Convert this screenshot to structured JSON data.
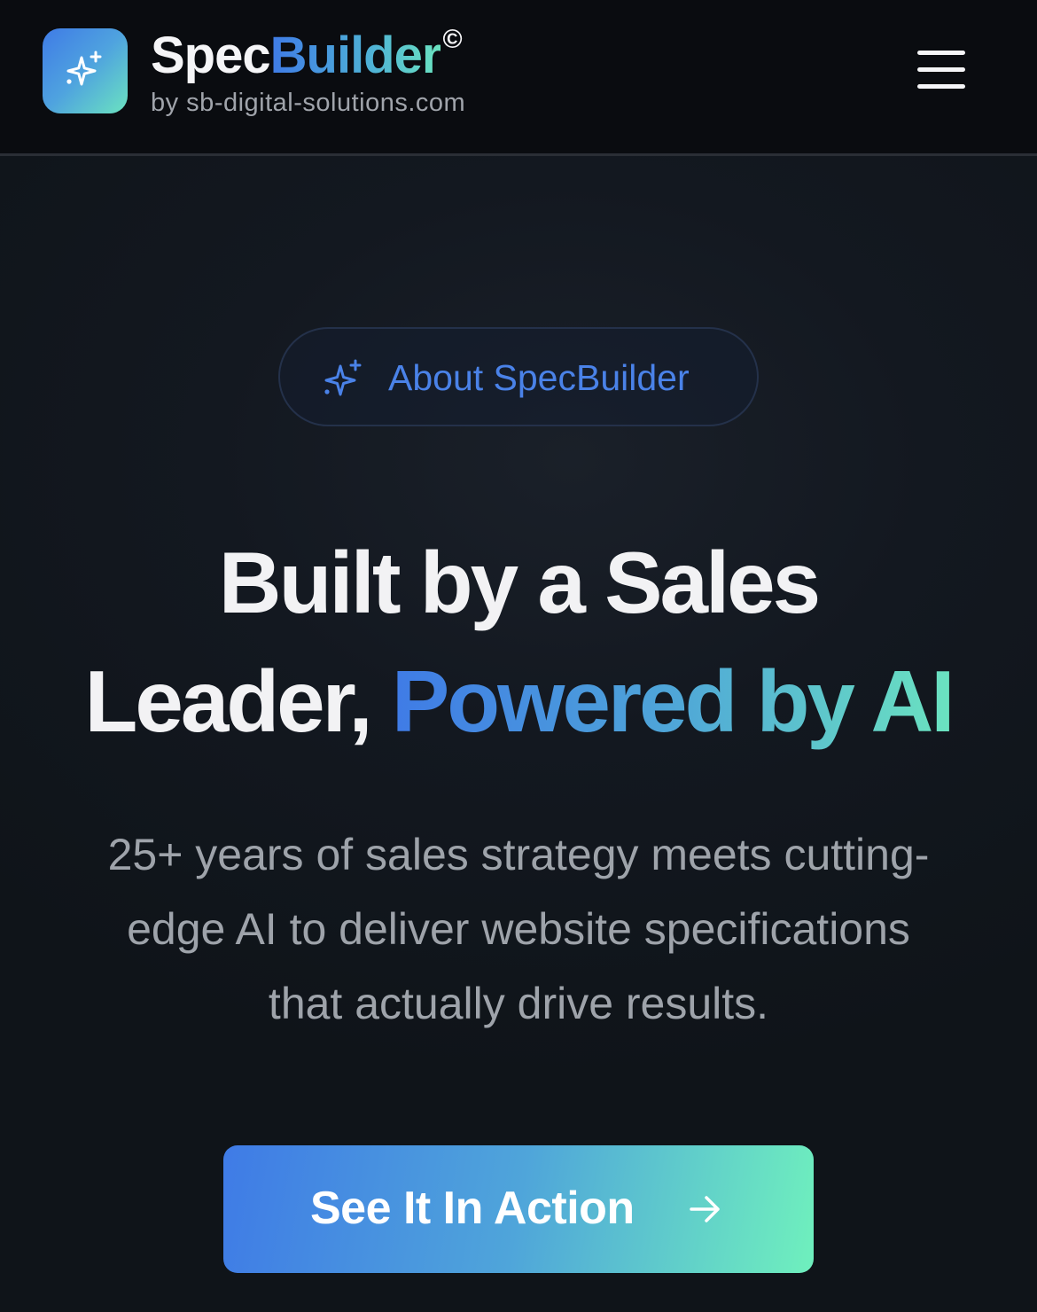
{
  "header": {
    "brand_part1": "Spec",
    "brand_part2": "Builder",
    "brand_mark": "©",
    "brand_sub": "by sb-digital-solutions.com",
    "logo_icon": "sparkles-icon",
    "menu_icon": "hamburger-menu-icon"
  },
  "badge": {
    "icon": "sparkles-icon",
    "label": "About SpecBuilder"
  },
  "hero": {
    "headline_line1": "Built by a Sales",
    "headline_line2_plain": "Leader, ",
    "headline_line2_accent": "Powered by AI",
    "subtext_line1": "25+ years of sales strategy meets cutting-",
    "subtext_line2": "edge AI to deliver website specifications",
    "subtext_line3": "that actually drive results."
  },
  "cta": {
    "label": "See It In Action",
    "icon": "arrow-right-icon"
  },
  "colors": {
    "background": "#0f1419",
    "header_background": "#0a0c10",
    "accent_blue": "#3f7be6",
    "accent_teal": "#6be3c0",
    "badge_text": "#4a82e8",
    "body_text": "#9ea3aa",
    "heading_text": "#f2f2f4"
  }
}
